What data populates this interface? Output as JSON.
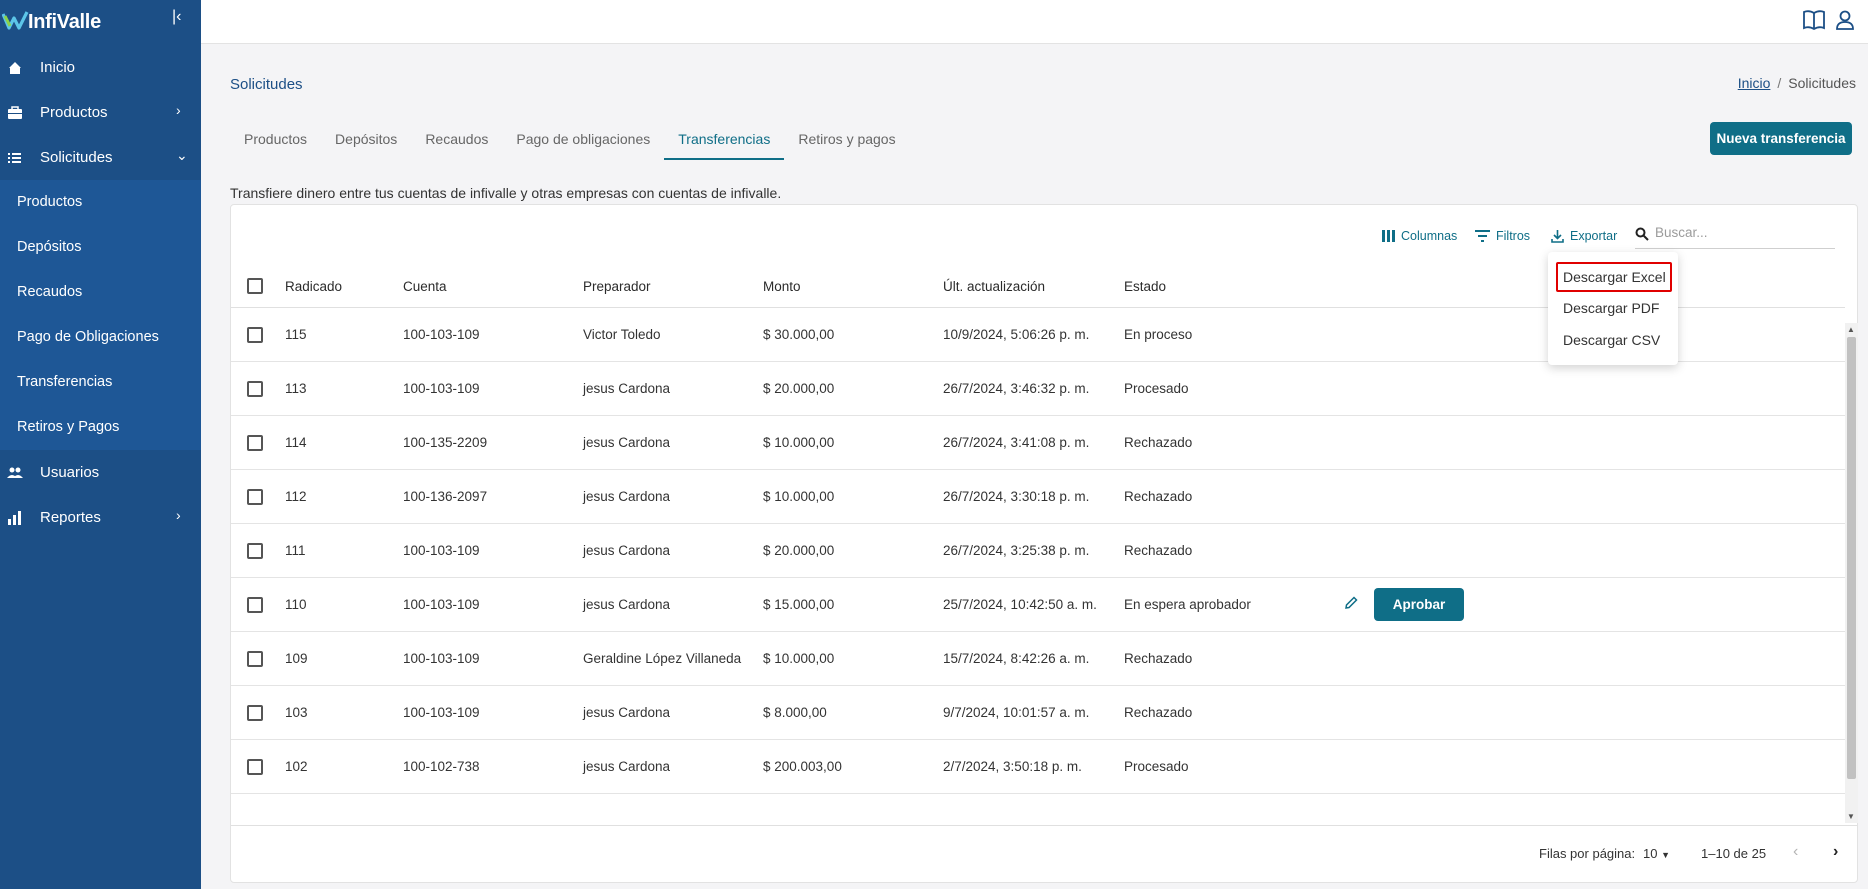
{
  "brand": {
    "name": "InfiValle"
  },
  "sidebar": {
    "items": [
      {
        "label": "Inicio",
        "icon": "home-icon"
      },
      {
        "label": "Productos",
        "icon": "briefcase-icon"
      },
      {
        "label": "Solicitudes",
        "icon": "list-icon"
      },
      {
        "label": "Usuarios",
        "icon": "users-icon"
      },
      {
        "label": "Reportes",
        "icon": "chart-icon"
      }
    ],
    "subitems": [
      "Productos",
      "Depósitos",
      "Recaudos",
      "Pago de Obligaciones",
      "Transferencias",
      "Retiros y Pagos"
    ]
  },
  "header": {
    "title": "Solicitudes"
  },
  "breadcrumb": {
    "home": "Inicio",
    "sep": "/",
    "current": "Solicitudes"
  },
  "tabs": [
    "Productos",
    "Depósitos",
    "Recaudos",
    "Pago de obligaciones",
    "Transferencias",
    "Retiros y pagos"
  ],
  "active_tab": "Transferencias",
  "new_button": "Nueva transferencia",
  "description": "Transfiere dinero entre tus cuentas de infivalle y otras empresas con cuentas de infivalle.",
  "toolbar": {
    "columns": "Columnas",
    "filters": "Filtros",
    "export": "Exportar",
    "search_placeholder": "Buscar..."
  },
  "export_menu": [
    "Descargar Excel",
    "Descargar PDF",
    "Descargar CSV"
  ],
  "table": {
    "headers": [
      "Radicado",
      "Cuenta",
      "Preparador",
      "Monto",
      "Últ. actualización",
      "Estado"
    ],
    "rows": [
      [
        "115",
        "100-103-109",
        "Victor Toledo",
        "$ 30.000,00",
        "10/9/2024, 5:06:26 p. m.",
        "En proceso"
      ],
      [
        "113",
        "100-103-109",
        "jesus Cardona",
        "$ 20.000,00",
        "26/7/2024, 3:46:32 p. m.",
        "Procesado"
      ],
      [
        "114",
        "100-135-2209",
        "jesus Cardona",
        "$ 10.000,00",
        "26/7/2024, 3:41:08 p. m.",
        "Rechazado"
      ],
      [
        "112",
        "100-136-2097",
        "jesus Cardona",
        "$ 10.000,00",
        "26/7/2024, 3:30:18 p. m.",
        "Rechazado"
      ],
      [
        "111",
        "100-103-109",
        "jesus Cardona",
        "$ 20.000,00",
        "26/7/2024, 3:25:38 p. m.",
        "Rechazado"
      ],
      [
        "110",
        "100-103-109",
        "jesus Cardona",
        "$ 15.000,00",
        "25/7/2024, 10:42:50 a. m.",
        "En espera aprobador"
      ],
      [
        "109",
        "100-103-109",
        "Geraldine López Villaneda",
        "$ 10.000,00",
        "15/7/2024, 8:42:26 a. m.",
        "Rechazado"
      ],
      [
        "103",
        "100-103-109",
        "jesus Cardona",
        "$ 8.000,00",
        "9/7/2024, 10:01:57 a. m.",
        "Rechazado"
      ],
      [
        "102",
        "100-102-738",
        "jesus Cardona",
        "$ 200.003,00",
        "2/7/2024, 3:50:18 p. m.",
        "Procesado"
      ]
    ],
    "approve_label": "Aprobar"
  },
  "footer": {
    "rows_per_page_label": "Filas por página:",
    "rows_per_page": "10",
    "range": "1–10 de 25"
  },
  "colors": {
    "sidebar": "#1c4f86",
    "accent": "#0f6e87",
    "highlight": "#e00000"
  }
}
